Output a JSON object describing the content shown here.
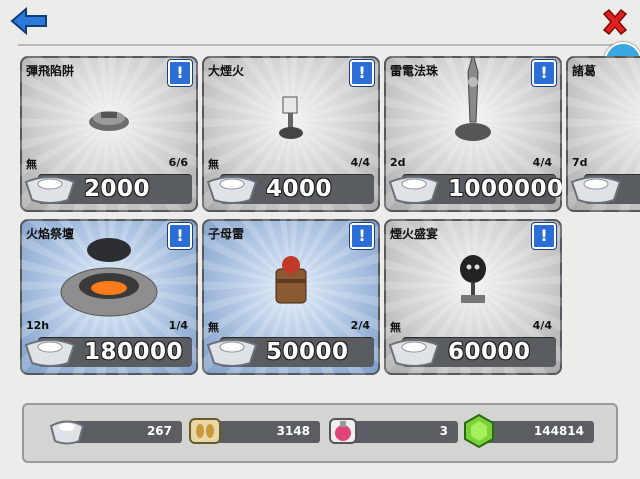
{
  "header": {
    "back_icon": "back-arrow-icon",
    "close_icon": "close-x-icon",
    "fun_badge": "fun"
  },
  "cards": [
    {
      "name": "彈飛陷阱",
      "time": "無",
      "count": "6/6",
      "price": "2000",
      "theme": "gray",
      "info": "!"
    },
    {
      "name": "大煙火",
      "time": "無",
      "count": "4/4",
      "price": "4000",
      "theme": "gray",
      "info": "!"
    },
    {
      "name": "雷電法珠",
      "time": "2d",
      "count": "4/4",
      "price": "1000000",
      "theme": "gray",
      "info": "!"
    },
    {
      "name": "諸葛",
      "time": "7d",
      "count": "",
      "price": "",
      "theme": "gray",
      "info": ""
    },
    {
      "name": "火焰祭壇",
      "time": "12h",
      "count": "1/4",
      "price": "180000",
      "theme": "blue",
      "info": "!"
    },
    {
      "name": "子母雷",
      "time": "無",
      "count": "2/4",
      "price": "50000",
      "theme": "blue",
      "info": "!"
    },
    {
      "name": "煙火盛宴",
      "time": "無",
      "count": "4/4",
      "price": "60000",
      "theme": "gray",
      "info": "!"
    }
  ],
  "resources": [
    {
      "icon": "silver-ingot-icon",
      "value": "267"
    },
    {
      "icon": "wheat-icon",
      "value": "3148"
    },
    {
      "icon": "potion-icon",
      "value": "3"
    },
    {
      "icon": "green-gem-icon",
      "value": "144814"
    }
  ]
}
